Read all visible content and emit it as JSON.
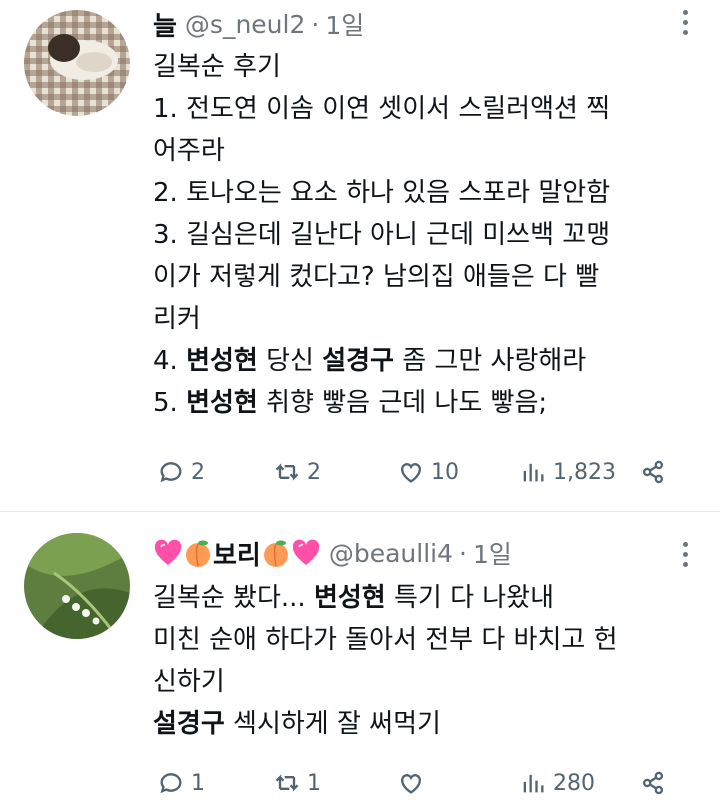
{
  "tweets": [
    {
      "author_name": "늘",
      "handle": "@s_neul2",
      "separator": "·",
      "time": "1일",
      "lines": [
        {
          "parts": [
            {
              "t": "길복순 후기",
              "b": false
            }
          ]
        },
        {
          "parts": [
            {
              "t": "1. 전도연 이솜 이연 셋이서 스릴러액션 찍",
              "b": false
            }
          ]
        },
        {
          "parts": [
            {
              "t": "어주라",
              "b": false
            }
          ]
        },
        {
          "parts": [
            {
              "t": "2. 토나오는 요소 하나 있음 스포라 말안함",
              "b": false
            }
          ]
        },
        {
          "parts": [
            {
              "t": "3. 길심은데 길난다 아니 근데 미쓰백 꼬맹",
              "b": false
            }
          ]
        },
        {
          "parts": [
            {
              "t": "이가 저렇게 컸다고? 남의집 애들은 다 빨",
              "b": false
            }
          ]
        },
        {
          "parts": [
            {
              "t": "리커",
              "b": false
            }
          ]
        },
        {
          "parts": [
            {
              "t": "4. ",
              "b": false
            },
            {
              "t": "변성현",
              "b": true
            },
            {
              "t": " 당신 ",
              "b": false
            },
            {
              "t": "설경구",
              "b": true
            },
            {
              "t": " 좀 그만 사랑해라",
              "b": false
            }
          ]
        },
        {
          "parts": [
            {
              "t": "5. ",
              "b": false
            },
            {
              "t": "변성현",
              "b": true
            },
            {
              "t": " 취향 빻음 근데 나도 빻음;",
              "b": false
            }
          ]
        }
      ],
      "replies": "2",
      "retweets": "2",
      "likes": "10",
      "views": "1,823"
    },
    {
      "author_name": "보리",
      "handle": "@beaulli4",
      "separator": "·",
      "time": "1일",
      "lines": [
        {
          "parts": [
            {
              "t": "길복순 봤다... ",
              "b": false
            },
            {
              "t": "변성현",
              "b": true
            },
            {
              "t": " 특기 다 나왔내",
              "b": false
            }
          ]
        },
        {
          "parts": [
            {
              "t": "미친 순애 하다가 돌아서 전부 다 바치고 헌",
              "b": false
            }
          ]
        },
        {
          "parts": [
            {
              "t": "신하기",
              "b": false
            }
          ]
        },
        {
          "parts": [
            {
              "t": "설경구",
              "b": true
            },
            {
              "t": " 섹시하게 잘 써먹기",
              "b": false
            }
          ]
        }
      ],
      "replies": "1",
      "retweets": "1",
      "likes": "",
      "views": "280"
    }
  ],
  "icons": {
    "reply": "speech-bubble-icon",
    "retweet": "retweet-arrows-icon",
    "like": "heart-outline-icon",
    "views": "bar-chart-icon",
    "share": "share-icon",
    "more": "three-dots-vertical-icon",
    "heart_emoji": "pink-heart-emoji",
    "peach_emoji": "peach-emoji"
  },
  "colors": {
    "text": "#0f1419",
    "secondary": "#6e767d",
    "divider": "#e6e9eb"
  }
}
